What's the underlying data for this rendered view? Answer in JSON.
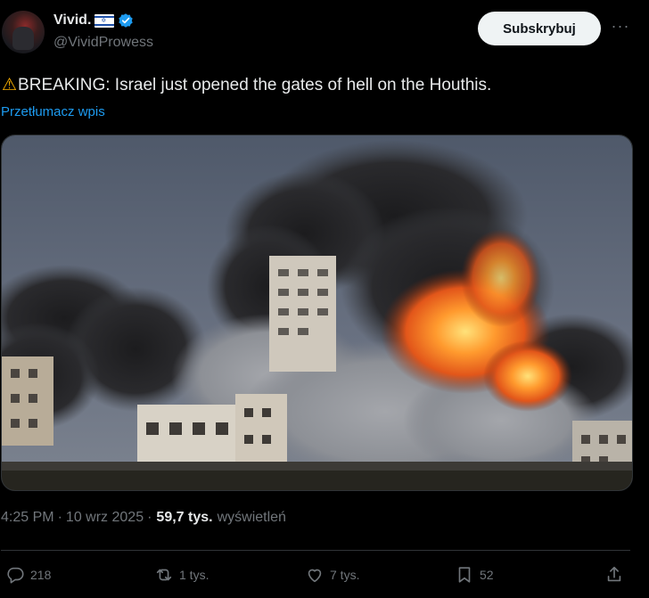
{
  "author": {
    "display_name": "Vivid.",
    "handle": "@VividProwess"
  },
  "header": {
    "subscribe_label": "Subskrybuj",
    "more_label": "···"
  },
  "tweet": {
    "text": "BREAKING: Israel just opened the gates of hell on the Houthis.",
    "translate_label": "Przetłumacz wpis"
  },
  "meta": {
    "time": "4:25 PM",
    "separator": "·",
    "date": "10 wrz 2025",
    "views_count": "59,7 tys.",
    "views_label": "wyświetleń"
  },
  "actions": {
    "replies": "218",
    "reposts": "1 tys.",
    "likes": "7 tys.",
    "bookmarks": "52"
  },
  "colors": {
    "background": "#000000",
    "text_primary": "#e7e9ea",
    "text_secondary": "#71767b",
    "link": "#1d9bf0",
    "verified": "#1d9bf0",
    "button_bg": "#eff3f4"
  },
  "icons": [
    "warning-icon",
    "verified-badge-icon",
    "israel-flag-icon",
    "more-icon",
    "reply-icon",
    "repost-icon",
    "like-icon",
    "bookmark-icon",
    "share-icon"
  ]
}
